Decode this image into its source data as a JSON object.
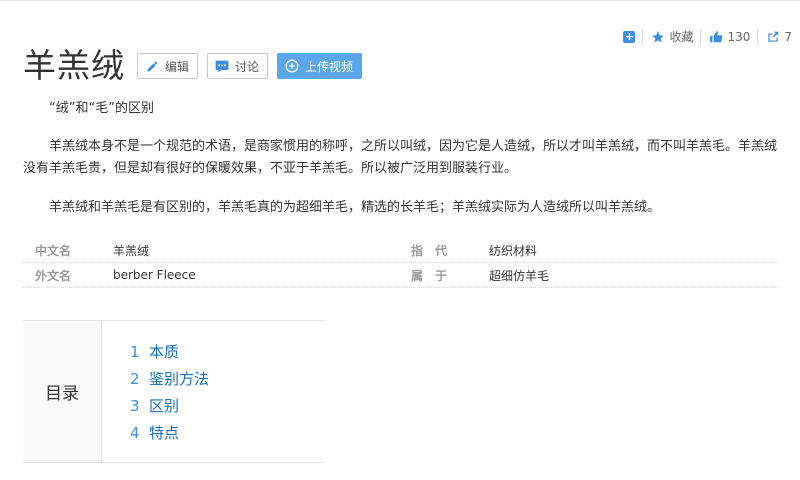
{
  "title": "羊羔绒",
  "buttons": {
    "edit": "编辑",
    "discuss": "讨论",
    "upload_video": "上传视频"
  },
  "actions": {
    "favorite": "收藏",
    "like_count": "130",
    "share_count": "7"
  },
  "paragraphs": [
    "“绒”和“毛”的区别",
    "羊羔绒本身不是一个规范的术语，是商家惯用的称呼，之所以叫绒，因为它是人造绒，所以才叫羊羔绒，而不叫羊羔毛。羊羔绒没有羊羔毛贵，但是却有很好的保暖效果，不亚于羊羔毛。所以被广泛用到服装行业。",
    "羊羔绒和羊羔毛是有区别的，羊羔毛真的为超细羊毛，精选的长羊毛；羊羔绒实际为人造绒所以叫羊羔绒。"
  ],
  "basic_info": {
    "rows": [
      {
        "key1": "中文名",
        "val1": "羊羔绒",
        "key2": "指代",
        "val2": "纺织材料"
      },
      {
        "key1": "外文名",
        "val1": "berber Fleece",
        "key2": "属于",
        "val2": "超细仿羊毛"
      }
    ]
  },
  "catalog": {
    "title": "目录",
    "items": [
      {
        "num": "1",
        "label": "本质"
      },
      {
        "num": "2",
        "label": "鉴别方法"
      },
      {
        "num": "3",
        "label": "区别"
      },
      {
        "num": "4",
        "label": "特点"
      }
    ]
  },
  "colors": {
    "accent": "#3c8ee0",
    "link": "#136ec2",
    "primary_button": "#5aa7ec"
  }
}
